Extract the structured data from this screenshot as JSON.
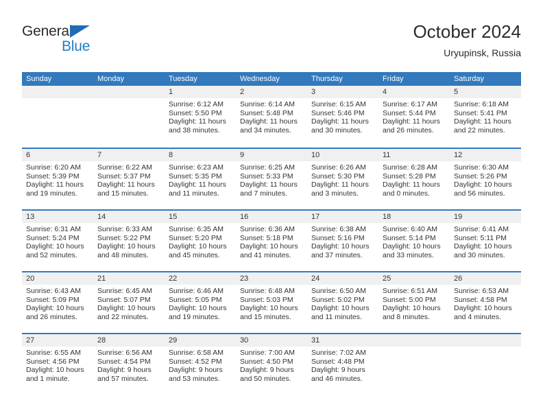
{
  "brand": {
    "name_top": "General",
    "name_bottom": "Blue"
  },
  "header": {
    "title": "October 2024",
    "subtitle": "Uryupinsk, Russia"
  },
  "colors": {
    "header_blue": "#3279bd",
    "brand_blue": "#1f7ec4",
    "day_band_gray": "#f0f0f0",
    "text": "#333333"
  },
  "weekdays": [
    "Sunday",
    "Monday",
    "Tuesday",
    "Wednesday",
    "Thursday",
    "Friday",
    "Saturday"
  ],
  "weeks": [
    [
      {
        "day": "",
        "sunrise": "",
        "sunset": "",
        "daylight_line1": "",
        "daylight_line2": ""
      },
      {
        "day": "",
        "sunrise": "",
        "sunset": "",
        "daylight_line1": "",
        "daylight_line2": ""
      },
      {
        "day": "1",
        "sunrise": "Sunrise: 6:12 AM",
        "sunset": "Sunset: 5:50 PM",
        "daylight_line1": "Daylight: 11 hours",
        "daylight_line2": "and 38 minutes."
      },
      {
        "day": "2",
        "sunrise": "Sunrise: 6:14 AM",
        "sunset": "Sunset: 5:48 PM",
        "daylight_line1": "Daylight: 11 hours",
        "daylight_line2": "and 34 minutes."
      },
      {
        "day": "3",
        "sunrise": "Sunrise: 6:15 AM",
        "sunset": "Sunset: 5:46 PM",
        "daylight_line1": "Daylight: 11 hours",
        "daylight_line2": "and 30 minutes."
      },
      {
        "day": "4",
        "sunrise": "Sunrise: 6:17 AM",
        "sunset": "Sunset: 5:44 PM",
        "daylight_line1": "Daylight: 11 hours",
        "daylight_line2": "and 26 minutes."
      },
      {
        "day": "5",
        "sunrise": "Sunrise: 6:18 AM",
        "sunset": "Sunset: 5:41 PM",
        "daylight_line1": "Daylight: 11 hours",
        "daylight_line2": "and 22 minutes."
      }
    ],
    [
      {
        "day": "6",
        "sunrise": "Sunrise: 6:20 AM",
        "sunset": "Sunset: 5:39 PM",
        "daylight_line1": "Daylight: 11 hours",
        "daylight_line2": "and 19 minutes."
      },
      {
        "day": "7",
        "sunrise": "Sunrise: 6:22 AM",
        "sunset": "Sunset: 5:37 PM",
        "daylight_line1": "Daylight: 11 hours",
        "daylight_line2": "and 15 minutes."
      },
      {
        "day": "8",
        "sunrise": "Sunrise: 6:23 AM",
        "sunset": "Sunset: 5:35 PM",
        "daylight_line1": "Daylight: 11 hours",
        "daylight_line2": "and 11 minutes."
      },
      {
        "day": "9",
        "sunrise": "Sunrise: 6:25 AM",
        "sunset": "Sunset: 5:33 PM",
        "daylight_line1": "Daylight: 11 hours",
        "daylight_line2": "and 7 minutes."
      },
      {
        "day": "10",
        "sunrise": "Sunrise: 6:26 AM",
        "sunset": "Sunset: 5:30 PM",
        "daylight_line1": "Daylight: 11 hours",
        "daylight_line2": "and 3 minutes."
      },
      {
        "day": "11",
        "sunrise": "Sunrise: 6:28 AM",
        "sunset": "Sunset: 5:28 PM",
        "daylight_line1": "Daylight: 11 hours",
        "daylight_line2": "and 0 minutes."
      },
      {
        "day": "12",
        "sunrise": "Sunrise: 6:30 AM",
        "sunset": "Sunset: 5:26 PM",
        "daylight_line1": "Daylight: 10 hours",
        "daylight_line2": "and 56 minutes."
      }
    ],
    [
      {
        "day": "13",
        "sunrise": "Sunrise: 6:31 AM",
        "sunset": "Sunset: 5:24 PM",
        "daylight_line1": "Daylight: 10 hours",
        "daylight_line2": "and 52 minutes."
      },
      {
        "day": "14",
        "sunrise": "Sunrise: 6:33 AM",
        "sunset": "Sunset: 5:22 PM",
        "daylight_line1": "Daylight: 10 hours",
        "daylight_line2": "and 48 minutes."
      },
      {
        "day": "15",
        "sunrise": "Sunrise: 6:35 AM",
        "sunset": "Sunset: 5:20 PM",
        "daylight_line1": "Daylight: 10 hours",
        "daylight_line2": "and 45 minutes."
      },
      {
        "day": "16",
        "sunrise": "Sunrise: 6:36 AM",
        "sunset": "Sunset: 5:18 PM",
        "daylight_line1": "Daylight: 10 hours",
        "daylight_line2": "and 41 minutes."
      },
      {
        "day": "17",
        "sunrise": "Sunrise: 6:38 AM",
        "sunset": "Sunset: 5:16 PM",
        "daylight_line1": "Daylight: 10 hours",
        "daylight_line2": "and 37 minutes."
      },
      {
        "day": "18",
        "sunrise": "Sunrise: 6:40 AM",
        "sunset": "Sunset: 5:14 PM",
        "daylight_line1": "Daylight: 10 hours",
        "daylight_line2": "and 33 minutes."
      },
      {
        "day": "19",
        "sunrise": "Sunrise: 6:41 AM",
        "sunset": "Sunset: 5:11 PM",
        "daylight_line1": "Daylight: 10 hours",
        "daylight_line2": "and 30 minutes."
      }
    ],
    [
      {
        "day": "20",
        "sunrise": "Sunrise: 6:43 AM",
        "sunset": "Sunset: 5:09 PM",
        "daylight_line1": "Daylight: 10 hours",
        "daylight_line2": "and 26 minutes."
      },
      {
        "day": "21",
        "sunrise": "Sunrise: 6:45 AM",
        "sunset": "Sunset: 5:07 PM",
        "daylight_line1": "Daylight: 10 hours",
        "daylight_line2": "and 22 minutes."
      },
      {
        "day": "22",
        "sunrise": "Sunrise: 6:46 AM",
        "sunset": "Sunset: 5:05 PM",
        "daylight_line1": "Daylight: 10 hours",
        "daylight_line2": "and 19 minutes."
      },
      {
        "day": "23",
        "sunrise": "Sunrise: 6:48 AM",
        "sunset": "Sunset: 5:03 PM",
        "daylight_line1": "Daylight: 10 hours",
        "daylight_line2": "and 15 minutes."
      },
      {
        "day": "24",
        "sunrise": "Sunrise: 6:50 AM",
        "sunset": "Sunset: 5:02 PM",
        "daylight_line1": "Daylight: 10 hours",
        "daylight_line2": "and 11 minutes."
      },
      {
        "day": "25",
        "sunrise": "Sunrise: 6:51 AM",
        "sunset": "Sunset: 5:00 PM",
        "daylight_line1": "Daylight: 10 hours",
        "daylight_line2": "and 8 minutes."
      },
      {
        "day": "26",
        "sunrise": "Sunrise: 6:53 AM",
        "sunset": "Sunset: 4:58 PM",
        "daylight_line1": "Daylight: 10 hours",
        "daylight_line2": "and 4 minutes."
      }
    ],
    [
      {
        "day": "27",
        "sunrise": "Sunrise: 6:55 AM",
        "sunset": "Sunset: 4:56 PM",
        "daylight_line1": "Daylight: 10 hours",
        "daylight_line2": "and 1 minute."
      },
      {
        "day": "28",
        "sunrise": "Sunrise: 6:56 AM",
        "sunset": "Sunset: 4:54 PM",
        "daylight_line1": "Daylight: 9 hours",
        "daylight_line2": "and 57 minutes."
      },
      {
        "day": "29",
        "sunrise": "Sunrise: 6:58 AM",
        "sunset": "Sunset: 4:52 PM",
        "daylight_line1": "Daylight: 9 hours",
        "daylight_line2": "and 53 minutes."
      },
      {
        "day": "30",
        "sunrise": "Sunrise: 7:00 AM",
        "sunset": "Sunset: 4:50 PM",
        "daylight_line1": "Daylight: 9 hours",
        "daylight_line2": "and 50 minutes."
      },
      {
        "day": "31",
        "sunrise": "Sunrise: 7:02 AM",
        "sunset": "Sunset: 4:48 PM",
        "daylight_line1": "Daylight: 9 hours",
        "daylight_line2": "and 46 minutes."
      },
      {
        "day": "",
        "sunrise": "",
        "sunset": "",
        "daylight_line1": "",
        "daylight_line2": ""
      },
      {
        "day": "",
        "sunrise": "",
        "sunset": "",
        "daylight_line1": "",
        "daylight_line2": ""
      }
    ]
  ]
}
